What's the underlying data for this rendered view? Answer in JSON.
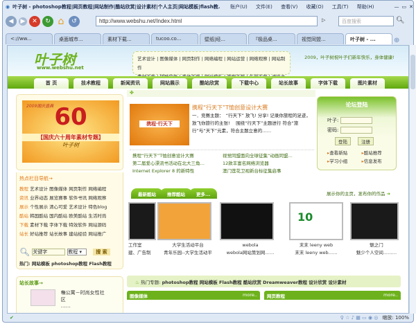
{
  "browser": {
    "title": "叶子树 - photoshop教程|网页教程|网站制作|酷站欣赏|设计素材|个人主页|网站模板|flash教...",
    "menu": [
      "账户(U)",
      "文件(E)",
      "查看(V)",
      "收藏(O)",
      "工具(T)",
      "帮助(H)"
    ],
    "url": "http://www.webshu.net/Index.html",
    "search_placeholder": "百度搜索",
    "tabs": [
      "<://ww...",
      "桌面城市...",
      "素材下载...",
      "tucoo.co...",
      "壁纸|经...",
      "『极品桌...",
      "视觉同盟...",
      "叶子树 - ..."
    ],
    "zoom": "缩放: 100%"
  },
  "header": {
    "logo": "叶子树",
    "logo_url": "www.webshu.net",
    "links_row1": "艺术设计 | 图像媒体 | 网页制作 | 网络编程 | 网站运营 | 网络观察 | 网站制作",
    "links_row2": "素材下载 | 辅助软件 | 字体下载 | 网站模板 | 笔刷下载 | 矢量下载 | 虚拟主机",
    "greeting": "2009，叶子树祝叶子们新年快乐，身体健康!"
  },
  "nav": [
    "首 页",
    "技术教程",
    "新闻资讯",
    "网站展示",
    "酷站欣赏",
    "下载中心",
    "站长故事",
    "字体下载",
    "图片素材"
  ],
  "banner": {
    "year": "2009国庆盛典",
    "number": "60",
    "caption": "【国庆六十周年素材专题】",
    "sign": "叶子树"
  },
  "hotnav": {
    "title": "热点栏目导航→",
    "rows": [
      {
        "cat": "教程",
        "items": [
          "艺术设计",
          "图像媒体",
          "网页制作",
          "网络编程"
        ]
      },
      {
        "cat": "资讯",
        "items": [
          "业界动态",
          "展览赛事",
          "软件书讯",
          "网络观察"
        ]
      },
      {
        "cat": "展示",
        "items": [
          "个性展示",
          "清心可爱",
          "艺术设计",
          "特色blog"
        ]
      },
      {
        "cat": "酷站",
        "items": [
          "韩国酷站",
          "国内酷站",
          "欧美酷站",
          "生活时尚"
        ]
      },
      {
        "cat": "下载",
        "items": [
          "素材下载",
          "字体下载",
          "特效软件",
          "网站源码"
        ]
      },
      {
        "cat": "站长",
        "items": [
          "好站推荐",
          "站长故事",
          "建站经验",
          "网站推广"
        ]
      }
    ]
  },
  "search": {
    "value": "关键字",
    "select": "教程",
    "button": "搜 索",
    "hot_label": "热门:",
    "hot": [
      "网站模板",
      "photoshop教程",
      "Flash教程"
    ]
  },
  "news": {
    "headline": "携程“行天下”T恤创意设计大赛",
    "img_text": "携程·行天下",
    "summary": "一．竞赛主题：　“行天下” 放飞! 分享! 记录你旅程的足迹，放飞你旅行的主张!　 围绕“行天下”主题进行 符合“旅行”与“天下”元素，符合主题立意的……",
    "links": [
      "携程“行天下”T恤创意设计大赛",
      "视觉同盟面向全球征集“动画同盟…",
      "第二届爱心漂流书活动在北大三角…",
      "12款丰富名网络浏览器",
      "Internet Explorer 8 的新特性",
      "澳门莲花卫视新台标征集启事"
    ]
  },
  "login": {
    "title": "论坛登陆",
    "user_label": "叶子:",
    "pass_label": "密码:",
    "login": "登陆",
    "register": "注册",
    "links": [
      "查看新贴",
      "酷站推荐",
      "学习小组",
      "信息发布"
    ]
  },
  "kuzhan": {
    "tabs": [
      "最新酷站",
      "推荐酷站",
      "更多..."
    ],
    "promo": "展示你的主页，发布你的作品",
    "items": [
      {
        "t": "工作室",
        "d": "建、广告制"
      },
      {
        "t": "大学生活动平台",
        "d": "青年乐园--大学生活动平"
      },
      {
        "t": "webola",
        "d": "webola网站策划网……"
      },
      {
        "t": "末末 leeny web",
        "d": "末末 leeny web……"
      },
      {
        "t": "魅之门",
        "d": "魅少个人空间...……"
      }
    ]
  },
  "story": {
    "title": "站长故事→",
    "item": "嘸公寓－时尚女性社区",
    "more": "……"
  },
  "hot_topics": {
    "label": "热门专题:",
    "items": [
      "photoshop教程",
      "网站模板",
      "Flash教程",
      "酷站欣赏",
      "Dreamweaver教程",
      "设计欣赏",
      "设计素材"
    ]
  },
  "sections": [
    {
      "title": "图像媒体",
      "more": "more.."
    },
    {
      "title": "网页教程",
      "more": "more.."
    }
  ]
}
